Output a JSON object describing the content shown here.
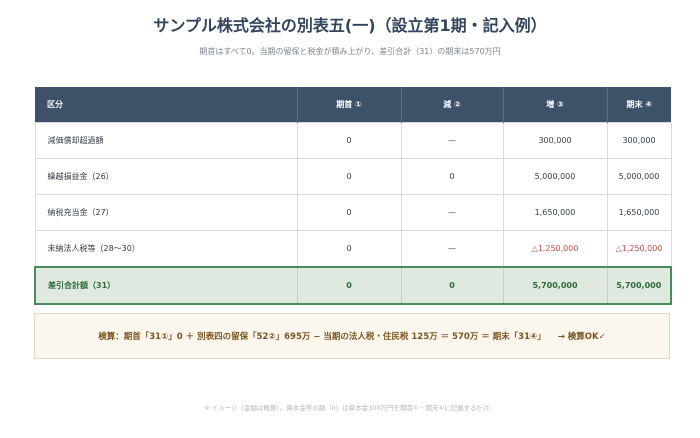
{
  "title": "サンプル株式会社の別表五(一)（設立第1期・記入例）",
  "subtitle": "期首はすべて0。当期の留保と税金が積み上がり、差引合計（31）の期末は570万円",
  "table": {
    "headers": [
      "区分",
      "期首 ①",
      "減 ②",
      "増 ③",
      "期末 ④"
    ],
    "rows": [
      [
        "減価償却超過額",
        "0",
        "—",
        "300,000",
        "300,000"
      ],
      [
        "繰越損益金（26）",
        "0",
        "0",
        "5,000,000",
        "5,000,000"
      ],
      [
        "納税充当金（27）",
        "0",
        "—",
        "1,650,000",
        "1,650,000"
      ],
      [
        "未納法人税等（28〜30）",
        "0",
        "—",
        "△1,250,000",
        "△1,250,000"
      ]
    ],
    "total": [
      "差引合計額（31）",
      "0",
      "0",
      "5,700,000",
      "5,700,000"
    ]
  },
  "check": {
    "text": "検算：期首「31①」0 ＋ 別表四の留保「52②」695万 − 当期の法人税・住民税 125万 ＝ 570万 ＝ 期末「31④」",
    "result": "→ 検算OK✓"
  },
  "note": "※ イメージ（金額は概算）。資本金等の額（II）は資本金300万円を期首①・期末④に記載するだけ。",
  "colors": {
    "header_bg": "#3d5269",
    "total_bg": "#dfe9df",
    "total_border": "#4b8a5a",
    "negative": "#c0504d",
    "check_bg": "#fbf7ef"
  }
}
